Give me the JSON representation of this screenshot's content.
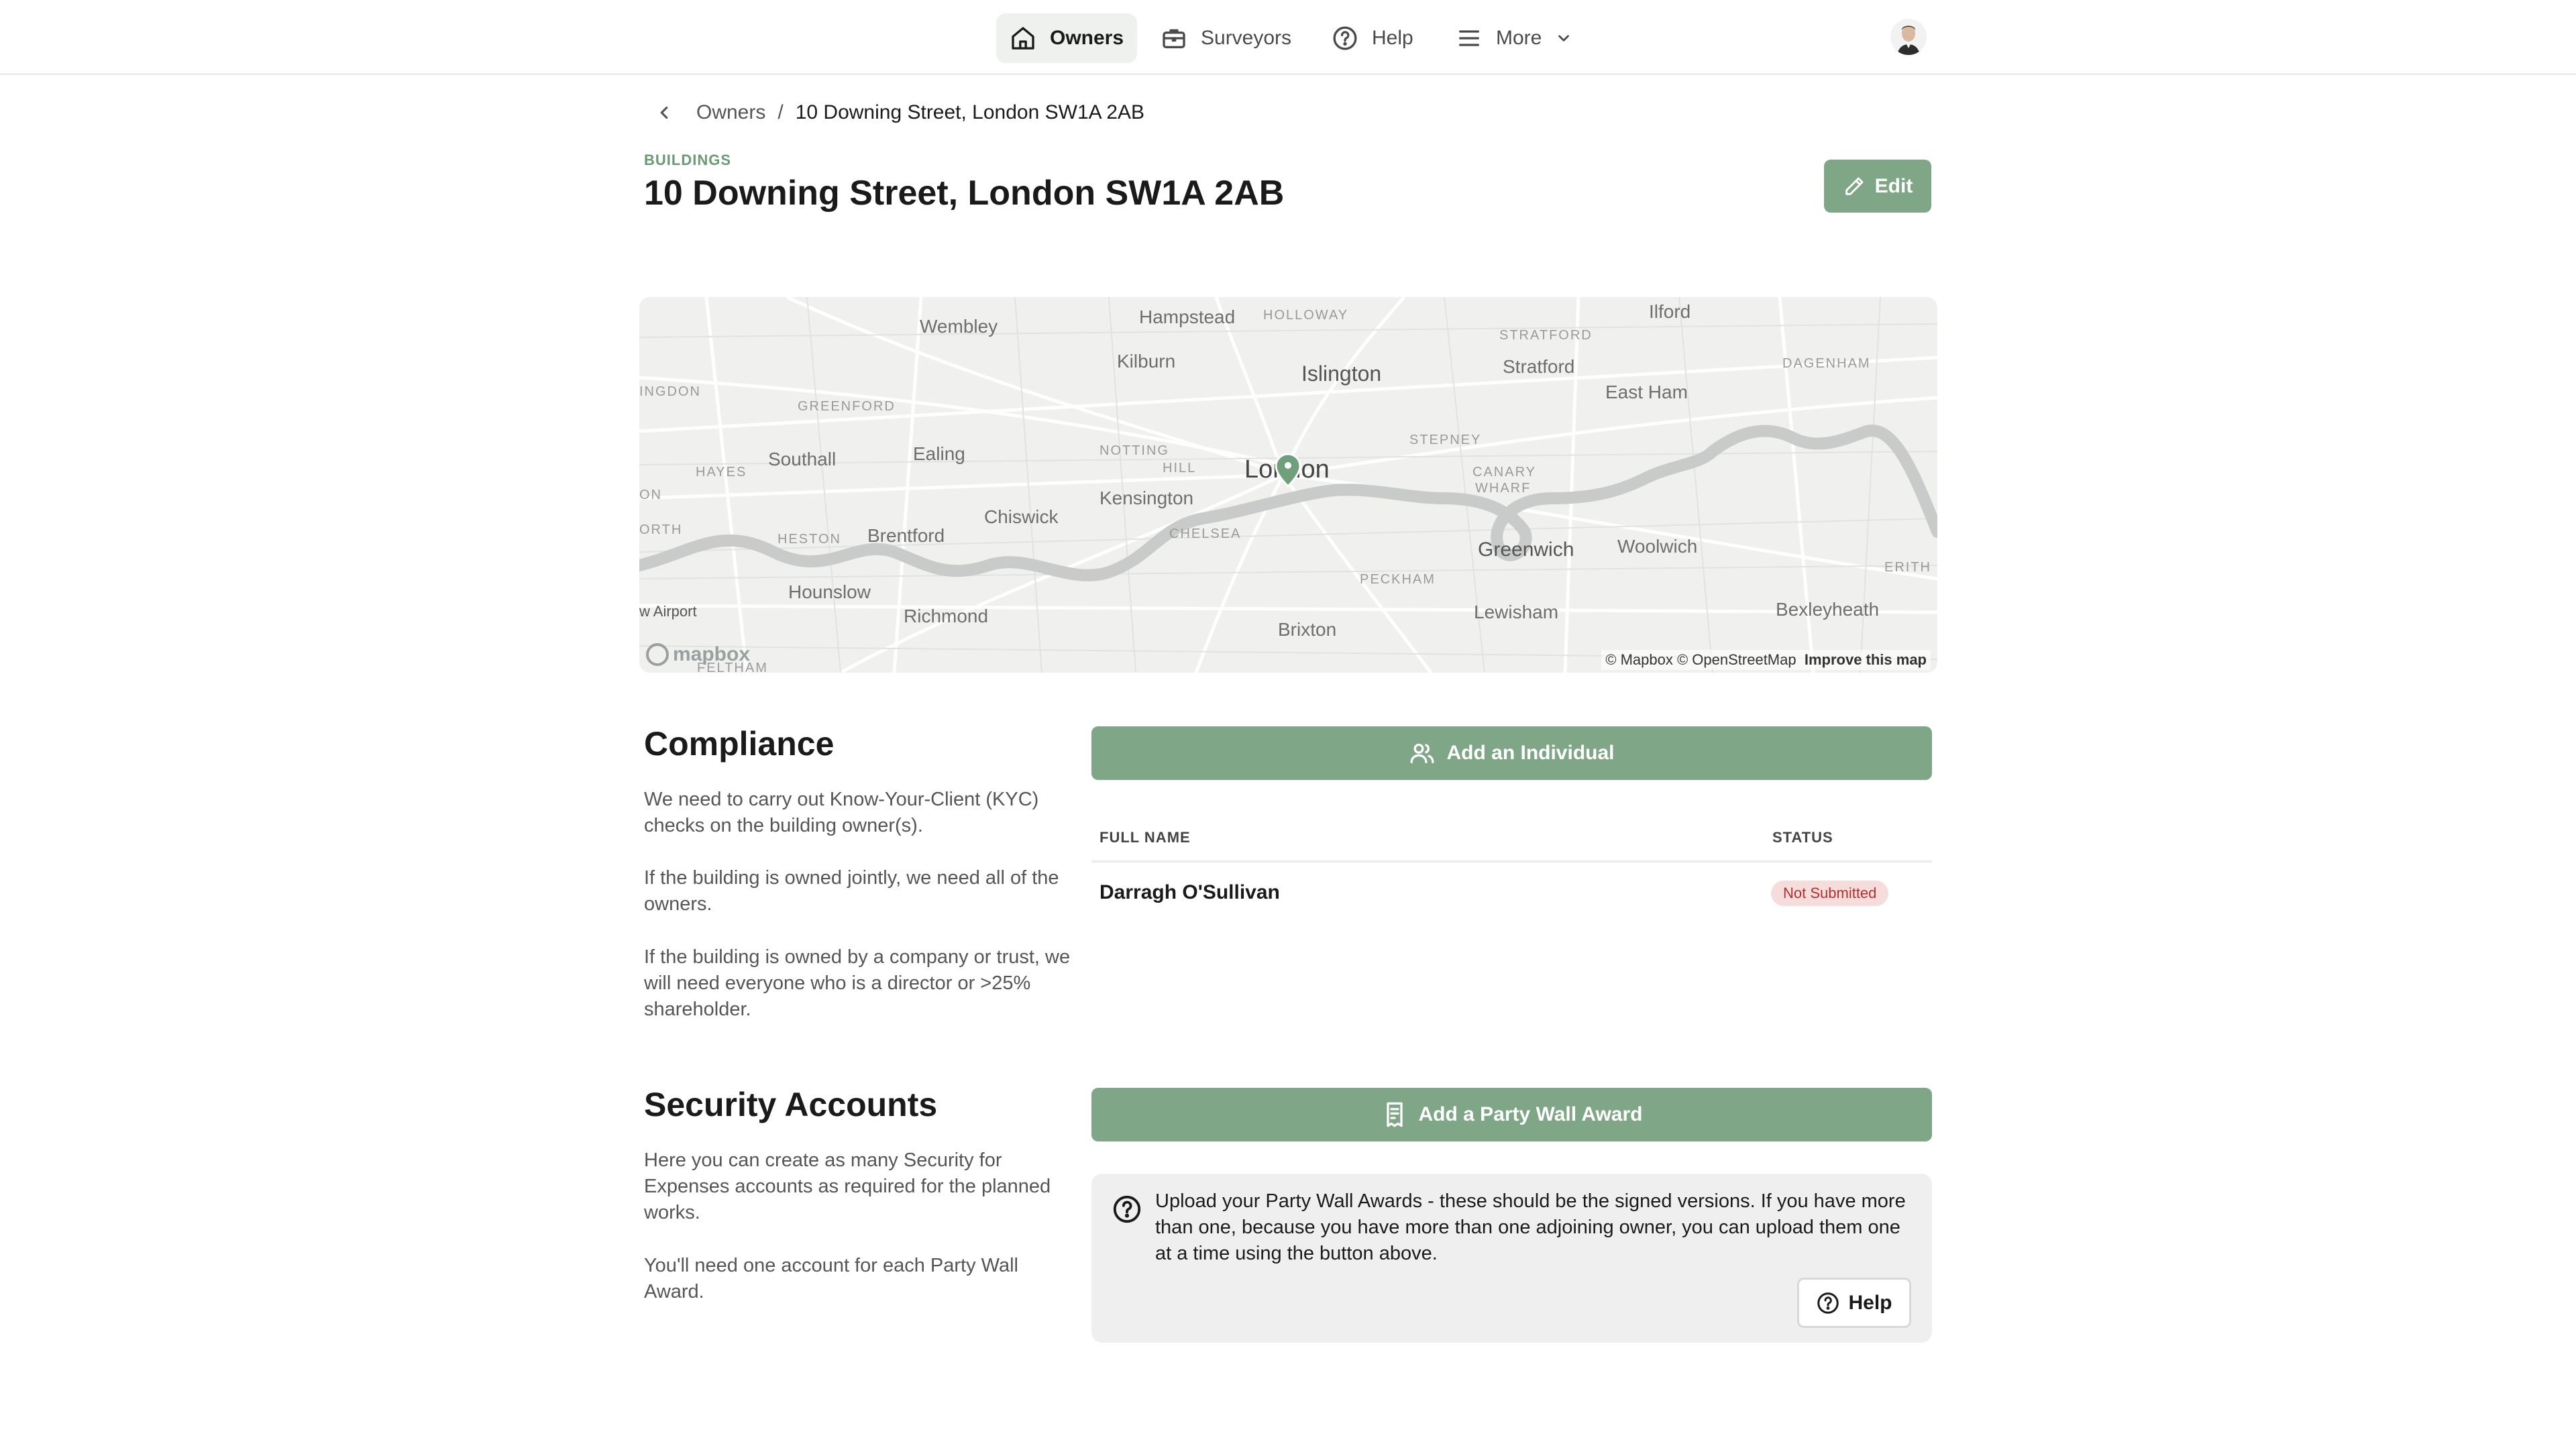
{
  "nav": {
    "items": [
      {
        "label": "Owners",
        "icon": "home-icon"
      },
      {
        "label": "Surveyors",
        "icon": "briefcase-icon"
      },
      {
        "label": "Help",
        "icon": "question-circle-icon"
      },
      {
        "label": "More",
        "icon": "menu-icon"
      }
    ],
    "active_index": 0
  },
  "breadcrumb": {
    "parent": "Owners",
    "separator": "/",
    "current": "10 Downing Street, London SW1A 2AB"
  },
  "header": {
    "section_tag": "BUILDINGS",
    "title": "10 Downing Street, London SW1A 2AB",
    "edit_label": "Edit"
  },
  "map": {
    "labels": {
      "wembley": "Wembley",
      "hampstead": "Hampstead",
      "holloway": "HOLLOWAY",
      "ilford": "Ilford",
      "kilburn": "Kilburn",
      "islington": "Islington",
      "stratford_district": "STRATFORD",
      "stratford": "Stratford",
      "dagenham": "DAGENHAM",
      "east_ham": "East Ham",
      "greenford": "GREENFORD",
      "ingdon": "INGDON",
      "ealing": "Ealing",
      "notting_hill_1": "NOTTING",
      "notting_hill_2": "HILL",
      "stepney": "STEPNEY",
      "canary_wharf_1": "CANARY",
      "canary_wharf_2": "WHARF",
      "hayes": "HAYES",
      "southall": "Southall",
      "kensington": "Kensington",
      "london": "London",
      "on": "ON",
      "chiswick": "Chiswick",
      "orth": "ORTH",
      "heston": "HESTON",
      "brentford": "Brentford",
      "chelsea": "CHELSEA",
      "greenwich": "Greenwich",
      "woolwich": "Woolwich",
      "erith": "ERITH",
      "hounslow": "Hounslow",
      "peckham": "PECKHAM",
      "airport": "w Airport",
      "richmond": "Richmond",
      "lewisham": "Lewisham",
      "bexleyheath": "Bexleyheath",
      "brixton": "Brixton",
      "feltham": "FELTHAM"
    },
    "logo_text": "mapbox",
    "attribution": "© Mapbox © OpenStreetMap",
    "improve_label": "Improve this map"
  },
  "compliance": {
    "heading": "Compliance",
    "paragraphs": [
      "We need to carry out Know-Your-Client (KYC) checks on the building owner(s).",
      "If the building is owned jointly, we need all of the owners.",
      "If the building is owned by a company or trust, we will need everyone who is a director or >25% shareholder."
    ],
    "add_button": "Add an Individual",
    "table": {
      "columns": [
        "FULL NAME",
        "STATUS"
      ],
      "rows": [
        {
          "name": "Darragh O'Sullivan",
          "status": "Not Submitted"
        }
      ]
    }
  },
  "security": {
    "heading": "Security Accounts",
    "paragraphs": [
      "Here you can create as many Security for Expenses accounts as required for the planned works.",
      "You'll need one account for each Party Wall Award."
    ],
    "add_button": "Add a Party Wall Award",
    "help_text": "Upload your Party Wall Awards - these should be the signed versions.  If you have more than one, because you have more than one adjoining owner, you can upload them one at a time using the button above.",
    "help_button": "Help"
  },
  "colors": {
    "accent": "#7fa687",
    "section_tag": "#6a9a72",
    "badge_bg": "#f7dcdc",
    "badge_text": "#b03030"
  }
}
